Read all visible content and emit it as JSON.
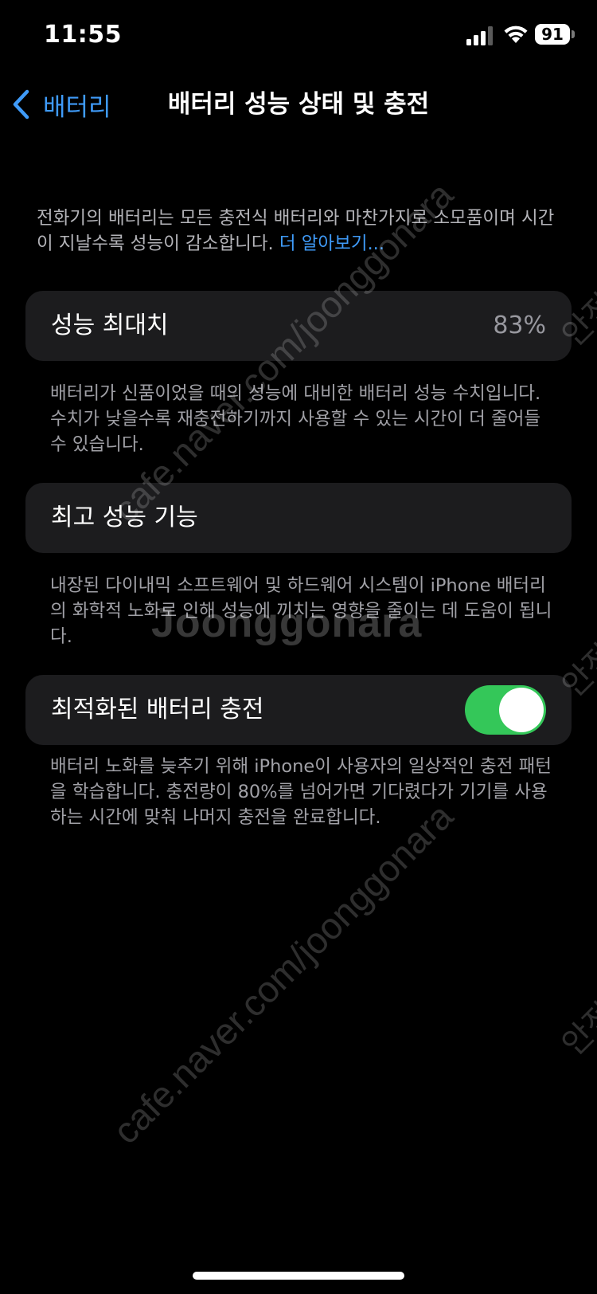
{
  "status_bar": {
    "time": "11:55",
    "battery_level": "91",
    "icons": [
      "cellular-signal-icon",
      "wifi-icon",
      "battery-icon"
    ]
  },
  "nav": {
    "back_label": "배터리",
    "title": "배터리 성능 상태 및 충전"
  },
  "intro": {
    "text": "전화기의 배터리는 모든 충전식 배터리와 마찬가지로 소모품이며 시간이 지날수록 성능이 감소합니다. ",
    "link": "더 알아보기..."
  },
  "maximum_capacity": {
    "label": "성능 최대치",
    "value": "83%",
    "footnote": "배터리가 신품이었을 때의 성능에 대비한 배터리 성능 수치입니다. 수치가 낮을수록 재충전하기까지 사용할 수 있는 시간이 더 줄어들 수 있습니다."
  },
  "peak_performance": {
    "label": "최고 성능 기능",
    "footnote": "내장된 다이내믹 소프트웨어 및 하드웨어 시스템이 iPhone 배터리의 화학적 노화로 인해 성능에 끼치는 영향을 줄이는 데 도움이 됩니다."
  },
  "optimized_charging": {
    "label": "최적화된 배터리 충전",
    "enabled": true,
    "footnote": "배터리 노화를 늦추기 위해 iPhone이 사용자의 일상적인 충전 패턴을 학습합니다. 충전량이 80%를 넘어가면 기다렸다가 기기를 사용하는 시간에 맞춰 나머지 충전을 완료합니다."
  },
  "watermark": {
    "url": "cafe.naver.com/joonggonara",
    "brand": "Joonggonara",
    "edge_text": "안전"
  },
  "colors": {
    "background": "#000000",
    "cell": "#1c1c1e",
    "link_blue": "#3f9bf9",
    "toggle_on": "#34c759"
  }
}
